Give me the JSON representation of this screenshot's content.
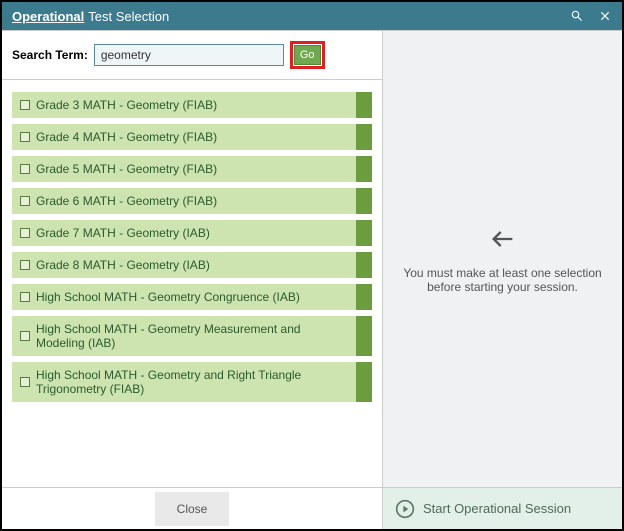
{
  "header": {
    "title_op": "Operational",
    "title_rest": "Test Selection"
  },
  "search": {
    "label": "Search Term:",
    "value": "geometry",
    "go_label": "Go"
  },
  "tests": [
    {
      "label": "Grade 3 MATH - Geometry (FIAB)"
    },
    {
      "label": "Grade 4 MATH - Geometry (FIAB)"
    },
    {
      "label": "Grade 5 MATH - Geometry (FIAB)"
    },
    {
      "label": "Grade 6 MATH - Geometry (FIAB)"
    },
    {
      "label": "Grade 7 MATH - Geometry (IAB)"
    },
    {
      "label": "Grade 8 MATH - Geometry (IAB)"
    },
    {
      "label": "High School MATH - Geometry Congruence (IAB)"
    },
    {
      "label": "High School MATH - Geometry Measurement and Modeling (IAB)"
    },
    {
      "label": "High School MATH - Geometry and Right Triangle Trigonometry (FIAB)"
    }
  ],
  "right_panel": {
    "message": "You must make at least one selection before starting your session."
  },
  "footer": {
    "close_label": "Close",
    "start_label": "Start Operational Session"
  }
}
